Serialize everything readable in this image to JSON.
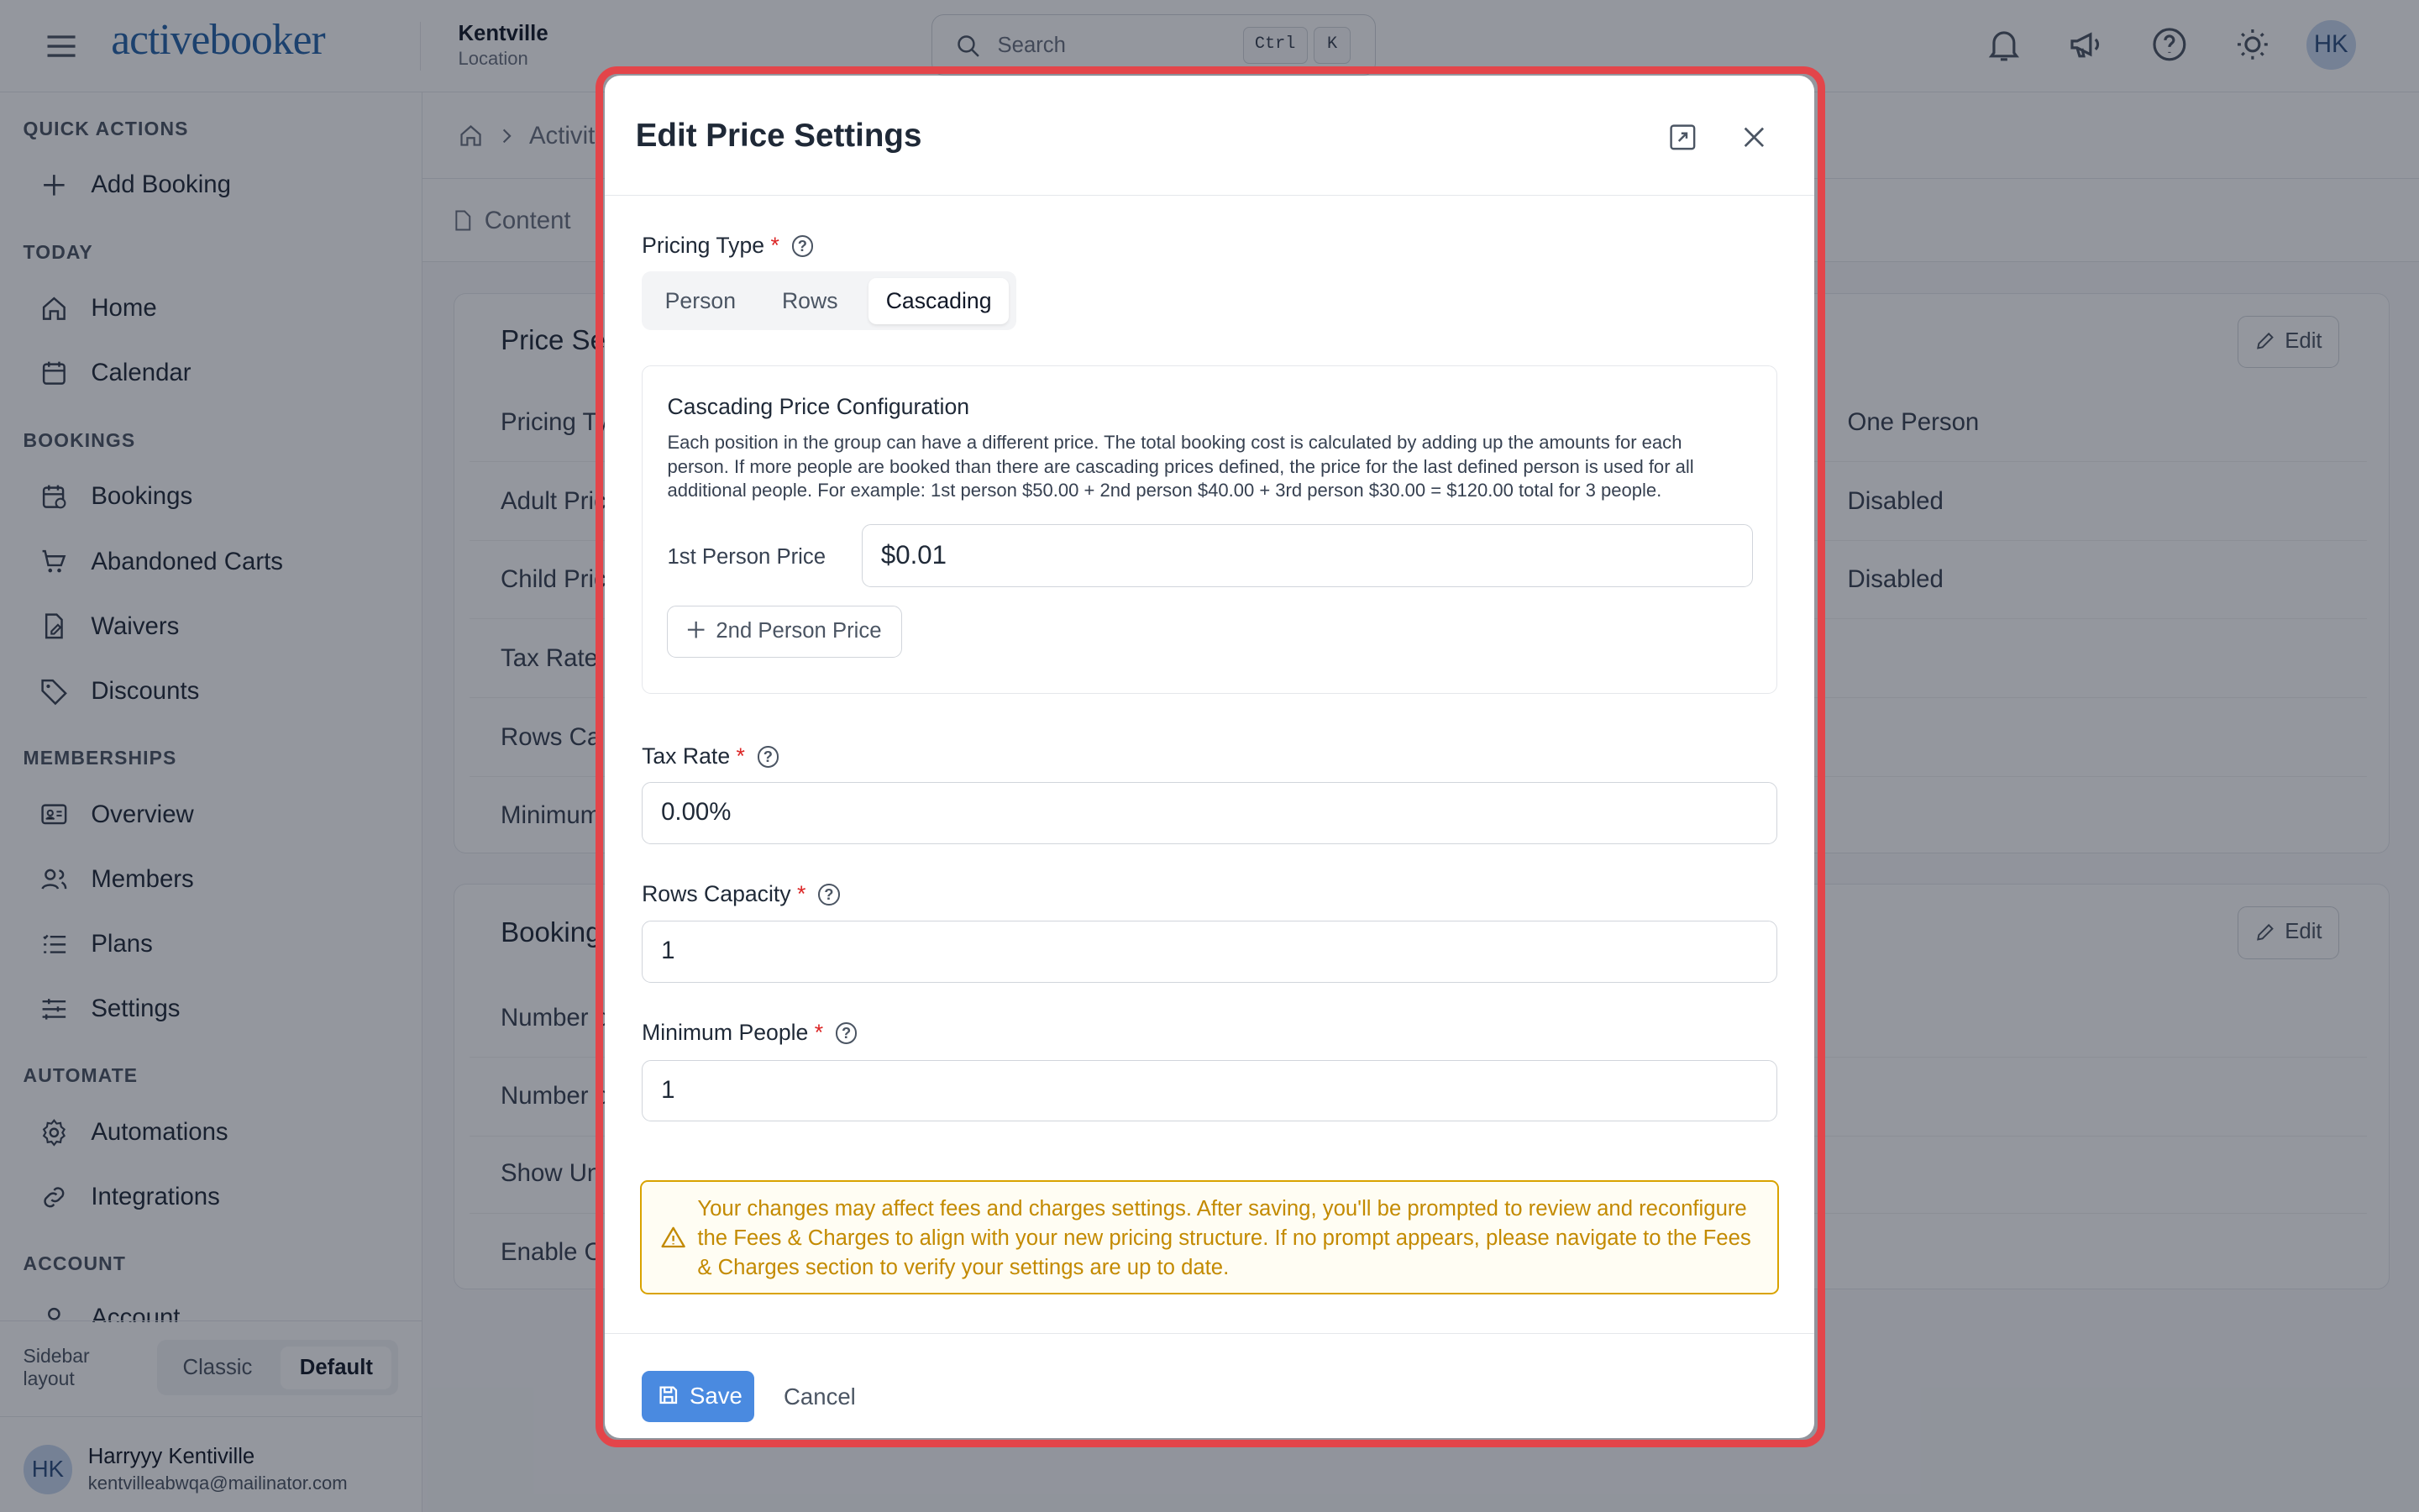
{
  "header": {
    "logo_text": "activebooker",
    "location_name": "Kentville",
    "location_sub": "Location",
    "search_placeholder": "Search",
    "kbd_ctrl": "Ctrl",
    "kbd_k": "K",
    "avatar_initials": "HK"
  },
  "sidebar": {
    "sections": {
      "quick_actions": "QUICK ACTIONS",
      "today": "TODAY",
      "bookings": "BOOKINGS",
      "memberships": "MEMBERSHIPS",
      "automate": "AUTOMATE",
      "account": "ACCOUNT"
    },
    "items": {
      "add_booking": "Add Booking",
      "home": "Home",
      "calendar": "Calendar",
      "bookings": "Bookings",
      "abandoned_carts": "Abandoned Carts",
      "waivers": "Waivers",
      "discounts": "Discounts",
      "overview": "Overview",
      "members": "Members",
      "plans": "Plans",
      "settings": "Settings",
      "automations": "Automations",
      "integrations": "Integrations",
      "account": "Account"
    },
    "layout_label": "Sidebar layout",
    "layout_options": [
      "Classic",
      "Default"
    ],
    "layout_selected": "Default",
    "user": {
      "initials": "HK",
      "name": "Harryyy Kentiville",
      "email": "kentvilleabwqa@mailinator.com"
    }
  },
  "main": {
    "breadcrumb_partial": "Activiti",
    "tab_content": "Content",
    "price_card": {
      "title_partial": "Price Se",
      "edit_label": "Edit",
      "rows": [
        {
          "label": "Pricing Ty",
          "value": "One Person"
        },
        {
          "label": "Adult Pric",
          "value": "Disabled"
        },
        {
          "label": "Child Pric",
          "value": "Disabled"
        },
        {
          "label": "Tax Rate",
          "value": ""
        },
        {
          "label": "Rows Ca",
          "value": ""
        },
        {
          "label": "Minimum",
          "value": ""
        }
      ]
    },
    "booking_card": {
      "title_partial": "Booking",
      "edit_label": "Edit",
      "rows": [
        {
          "label": "Number o"
        },
        {
          "label": "Number o"
        },
        {
          "label": "Show Un"
        },
        {
          "label": "Enable O"
        }
      ]
    }
  },
  "modal": {
    "title": "Edit Price Settings",
    "pricing_type_label": "Pricing Type",
    "required_mark": "*",
    "pricing_type_options": [
      "Person",
      "Rows",
      "Cascading"
    ],
    "pricing_type_selected": "Cascading",
    "cascading": {
      "title": "Cascading Price Configuration",
      "description": "Each position in the group can have a different price. The total booking cost is calculated by adding up the amounts for each person. If more people are booked than there are cascading prices defined, the price for the last defined person is used for all additional people. For example: 1st person $50.00 + 2nd person $40.00 + 3rd person $30.00 = $120.00 total for 3 people.",
      "first_person_label": "1st Person Price",
      "first_person_value": "$0.01",
      "add_second_label": "2nd Person Price"
    },
    "tax_rate_label": "Tax Rate",
    "tax_rate_value": "0.00%",
    "rows_capacity_label": "Rows Capacity",
    "rows_capacity_value": "1",
    "minimum_people_label": "Minimum People",
    "minimum_people_value": "1",
    "warning_text": "Your changes may affect fees and charges settings. After saving, you'll be prompted to review and reconfigure the Fees & Charges to align with your new pricing structure. If no prompt appears, please navigate to the Fees & Charges section to verify your settings are up to date.",
    "save_label": "Save",
    "cancel_label": "Cancel"
  },
  "colors": {
    "accent": "#4a8ae0",
    "brand": "#2563a8",
    "highlight_outline": "#e3454a",
    "warning": "#c38a00",
    "required": "#dc2626"
  },
  "icons": [
    "menu-icon",
    "search-icon",
    "bell-icon",
    "megaphone-icon",
    "help-icon",
    "sun-icon",
    "plus-icon",
    "home-icon",
    "calendar-icon",
    "calendar-clock-icon",
    "cart-icon",
    "waiver-icon",
    "tag-icon",
    "id-card-icon",
    "users-icon",
    "list-icon",
    "sliders-icon",
    "gear-icon",
    "link-icon",
    "user-icon",
    "file-icon",
    "pencil-icon",
    "expand-icon",
    "close-icon",
    "help-circle-icon",
    "warning-icon",
    "save-icon"
  ]
}
